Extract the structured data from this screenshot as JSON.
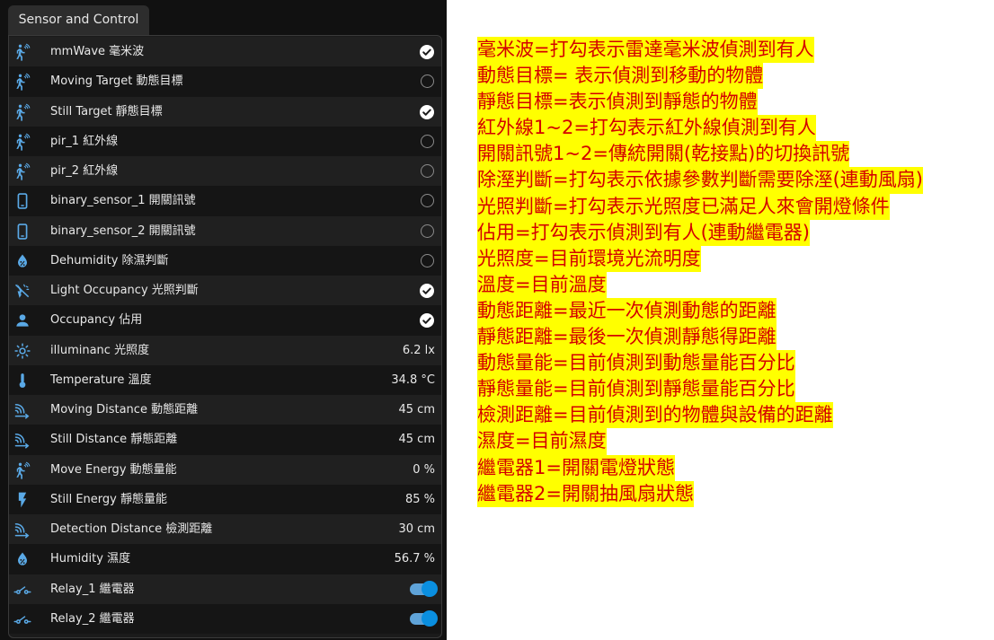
{
  "tab": {
    "label": "Sensor and Control"
  },
  "colors": {
    "accent": "#0a8fe0",
    "icon": "#5aa9e6",
    "note_text": "#d40000",
    "note_bg": "#ffff00"
  },
  "rows": [
    {
      "icon": "walk-radar-icon",
      "label": "mmWave 毫米波",
      "state": "checked"
    },
    {
      "icon": "walk-radar-icon",
      "label": "Moving Target 動態目標",
      "state": "unchecked"
    },
    {
      "icon": "walk-radar-icon",
      "label": "Still Target 靜態目標",
      "state": "checked"
    },
    {
      "icon": "walk-radar-icon",
      "label": "pir_1 紅外線",
      "state": "unchecked"
    },
    {
      "icon": "walk-radar-icon",
      "label": "pir_2 紅外線",
      "state": "unchecked"
    },
    {
      "icon": "phone-icon",
      "label": "binary_sensor_1 開關訊號",
      "state": "unchecked"
    },
    {
      "icon": "phone-icon",
      "label": "binary_sensor_2 開關訊號",
      "state": "unchecked"
    },
    {
      "icon": "water-drop-icon",
      "label": "Dehumidity 除濕判斷",
      "state": "unchecked"
    },
    {
      "icon": "light-off-icon",
      "label": "Light Occupancy 光照判斷",
      "state": "checked"
    },
    {
      "icon": "person-icon",
      "label": "Occupancy 佔用",
      "state": "checked"
    },
    {
      "icon": "brightness-icon",
      "label": "illuminanc 光照度",
      "value": "6.2 lx"
    },
    {
      "icon": "thermometer-icon",
      "label": "Temperature 溫度",
      "value": "34.8 °C"
    },
    {
      "icon": "signal-distance-icon",
      "label": "Moving Distance 動態距離",
      "value": "45 cm"
    },
    {
      "icon": "signal-distance-icon",
      "label": "Still Distance 靜態距離",
      "value": "45 cm"
    },
    {
      "icon": "walk-radar-icon",
      "label": "Move Energy 動態量能",
      "value": "0 %"
    },
    {
      "icon": "flash-icon",
      "label": "Still Energy 靜態量能",
      "value": "85 %"
    },
    {
      "icon": "signal-distance-icon",
      "label": "Detection Distance 檢測距離",
      "value": "30 cm"
    },
    {
      "icon": "water-drop-icon",
      "label": "Humidity 濕度",
      "value": "56.7 %"
    },
    {
      "icon": "electric-switch-icon",
      "label": "Relay_1 繼電器",
      "toggle": "on"
    },
    {
      "icon": "electric-switch-icon",
      "label": "Relay_2 繼電器",
      "toggle": "on"
    }
  ],
  "notes": [
    "毫米波=打勾表示雷達毫米波偵測到有人",
    "動態目標= 表示偵測到移動的物體",
    "靜態目標=表示偵測到靜態的物體",
    "紅外線1~2=打勾表示紅外線偵測到有人",
    "開關訊號1~2=傳統開關(乾接點)的切換訊號",
    "除溼判斷=打勾表示依據參數判斷需要除溼(連動風扇)",
    "光照判斷=打勾表示光照度已滿足人來會開燈條件",
    "佔用=打勾表示偵測到有人(連動繼電器)",
    "光照度=目前環境光流明度",
    "溫度=目前溫度",
    "動態距離=最近一次偵測動態的距離",
    "靜態距離=最後一次偵測靜態得距離",
    "動態量能=目前偵測到動態量能百分比",
    "靜態量能=目前偵測到靜態量能百分比",
    "檢測距離=目前偵測到的物體與設備的距離",
    "濕度=目前濕度",
    "繼電器1=開關電燈狀態",
    "繼電器2=開關抽風扇狀態"
  ]
}
